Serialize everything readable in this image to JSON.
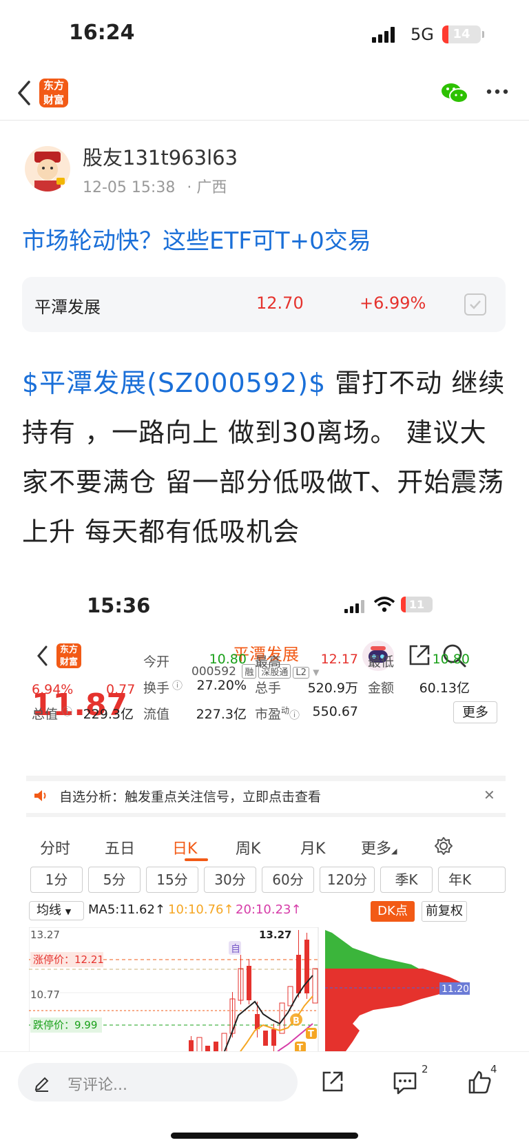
{
  "status_bar": {
    "time": "16:24",
    "network": "5G",
    "battery": "14"
  },
  "nav": {
    "logo_line1": "东方",
    "logo_line2": "财富"
  },
  "post": {
    "author": "股友131t963l63",
    "date": "12-05 15:38",
    "location": "· 广西",
    "title": "市场轮动快？这些ETF可T+0交易",
    "stock_card": {
      "name": "平潭发展",
      "price": "12.70",
      "change": "+6.99%"
    },
    "body_tag": "$平潭发展(SZ000592)$",
    "body_text": " 雷打不动 继续持有 ，一路向上 做到30离场。 建议大家不要满仓 留一部分低吸做T、开始震荡上升 每天都有低吸机会"
  },
  "screenshot": {
    "status_time": "15:36",
    "battery": "11",
    "logo_line1": "东方",
    "logo_line2": "财富",
    "stock_name": "平潭发展",
    "code": "000592",
    "tags": [
      "融",
      "深股通",
      "L2"
    ],
    "price": "11.87",
    "change_pct": "6.94%",
    "change_abs": "0.77",
    "quote": {
      "open_label": "今开",
      "open": "10.80",
      "high_label": "最高",
      "high": "12.17",
      "low_label": "最低",
      "low": "10.80",
      "turnover_label": "换手",
      "turnover": "27.20%",
      "volume_label": "总手",
      "volume": "520.9万",
      "amount_label": "金额",
      "amount": "60.13亿",
      "total_cap_label": "总值",
      "total_cap": "229.3亿",
      "float_cap_label": "流值",
      "float_cap": "227.3亿",
      "pe_label": "市盈",
      "pe_sup": "动",
      "pe": "550.67",
      "more": "更多"
    },
    "notice": "自选分析：触发重点关注信号，立即点击查看",
    "tabs": [
      "分时",
      "五日",
      "日K",
      "周K",
      "月K",
      "更多"
    ],
    "periods": [
      "1分",
      "5分",
      "15分",
      "30分",
      "60分",
      "120分",
      "季K",
      "年K"
    ],
    "ma_select": "均线",
    "ma5": "MA5:11.62↑",
    "ma10": "10:10.76↑",
    "ma20": "20:10.23↑",
    "dk_button": "DK点",
    "adjust_button": "前复权",
    "chart_labels": {
      "top_price": "13.27",
      "max_marker": "13.27",
      "mid_price": "10.77",
      "limit_up": "涨停价：12.21",
      "limit_down": "跌停价：9.99",
      "self_marker": "自",
      "b_marker": "B",
      "t_marker": "T",
      "profile_price": "11.20"
    }
  },
  "bottom_bar": {
    "comment_placeholder": "写评论...",
    "comment_count": "2",
    "like_count": "4"
  }
}
